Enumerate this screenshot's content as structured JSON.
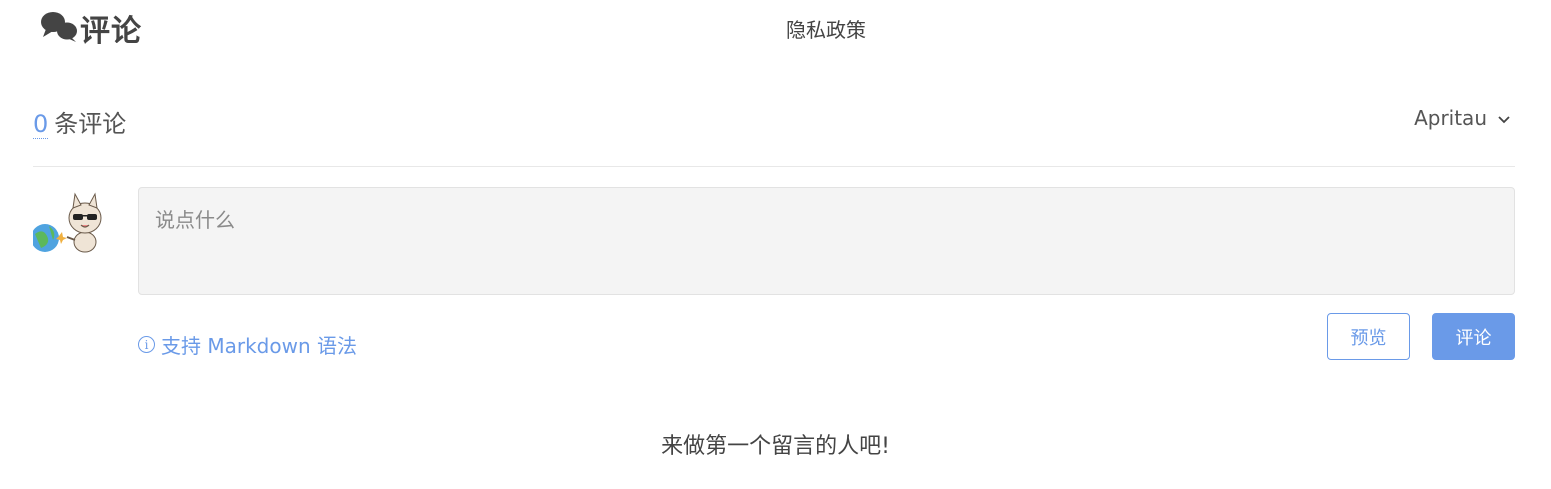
{
  "header": {
    "title": "评论",
    "privacy_link": "隐私政策"
  },
  "comments": {
    "count": "0",
    "count_label": "条评论",
    "user_name": "Apritau"
  },
  "editor": {
    "placeholder": "说点什么",
    "markdown_hint": "支持 Markdown 语法",
    "preview_label": "预览",
    "submit_label": "评论"
  },
  "empty_message": "来做第一个留言的人吧!",
  "colors": {
    "accent": "#6a9ae8",
    "input_bg": "#f4f4f4"
  },
  "icons": {
    "title_icon": "chat-bubbles-icon",
    "user_menu": "chevron-down-icon",
    "hint": "info-icon"
  }
}
